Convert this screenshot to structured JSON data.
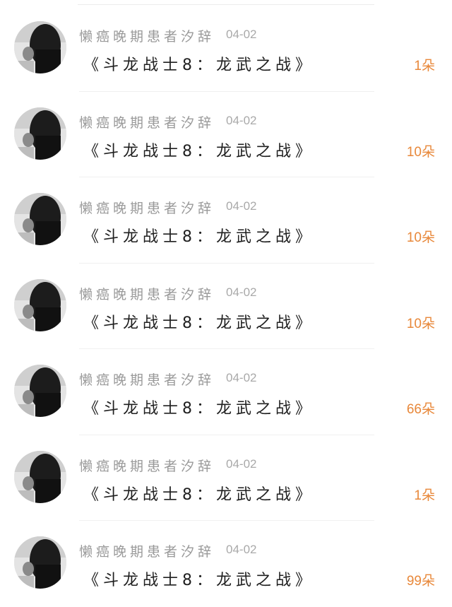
{
  "entries": [
    {
      "username": "懒癌晚期患者汐辞",
      "date": "04-02",
      "title": "《斗龙战士8：龙武之战》",
      "flowers": "1朵"
    },
    {
      "username": "懒癌晚期患者汐辞",
      "date": "04-02",
      "title": "《斗龙战士8：龙武之战》",
      "flowers": "10朵"
    },
    {
      "username": "懒癌晚期患者汐辞",
      "date": "04-02",
      "title": "《斗龙战士8：龙武之战》",
      "flowers": "10朵"
    },
    {
      "username": "懒癌晚期患者汐辞",
      "date": "04-02",
      "title": "《斗龙战士8：龙武之战》",
      "flowers": "10朵"
    },
    {
      "username": "懒癌晚期患者汐辞",
      "date": "04-02",
      "title": "《斗龙战士8：龙武之战》",
      "flowers": "66朵"
    },
    {
      "username": "懒癌晚期患者汐辞",
      "date": "04-02",
      "title": "《斗龙战士8：龙武之战》",
      "flowers": "1朵"
    },
    {
      "username": "懒癌晚期患者汐辞",
      "date": "04-02",
      "title": "《斗龙战士8：龙武之战》",
      "flowers": "99朵"
    }
  ],
  "colors": {
    "username": "#9a9a9a",
    "date": "#a9a9a9",
    "title": "#1f1f1f",
    "flowers": "#e8883a",
    "divider": "#f0f0f0"
  }
}
